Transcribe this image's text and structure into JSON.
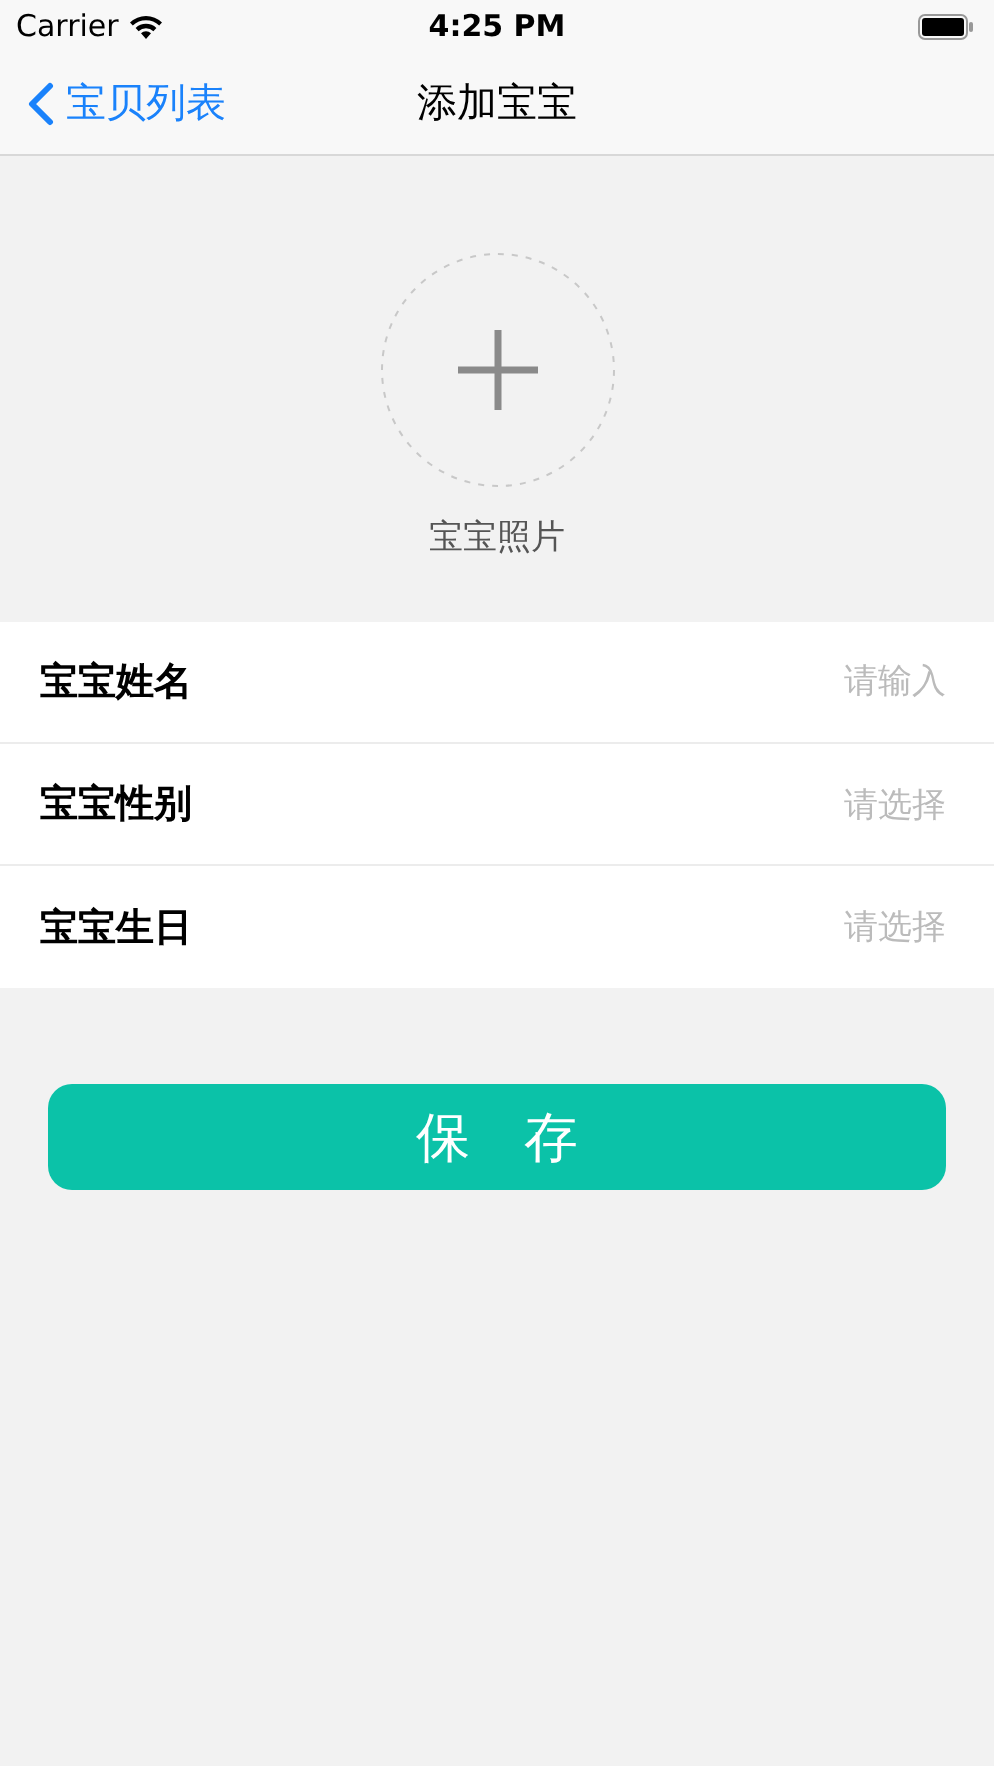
{
  "status_bar": {
    "carrier": "Carrier",
    "time": "4:25 PM"
  },
  "nav_bar": {
    "back_label": "宝贝列表",
    "title": "添加宝宝"
  },
  "photo": {
    "label": "宝宝照片"
  },
  "fields": [
    {
      "label": "宝宝姓名",
      "placeholder": "请输入",
      "kind": "input"
    },
    {
      "label": "宝宝性别",
      "placeholder": "请选择",
      "kind": "select"
    },
    {
      "label": "宝宝生日",
      "placeholder": "请选择",
      "kind": "select"
    }
  ],
  "save_button": "保　存"
}
